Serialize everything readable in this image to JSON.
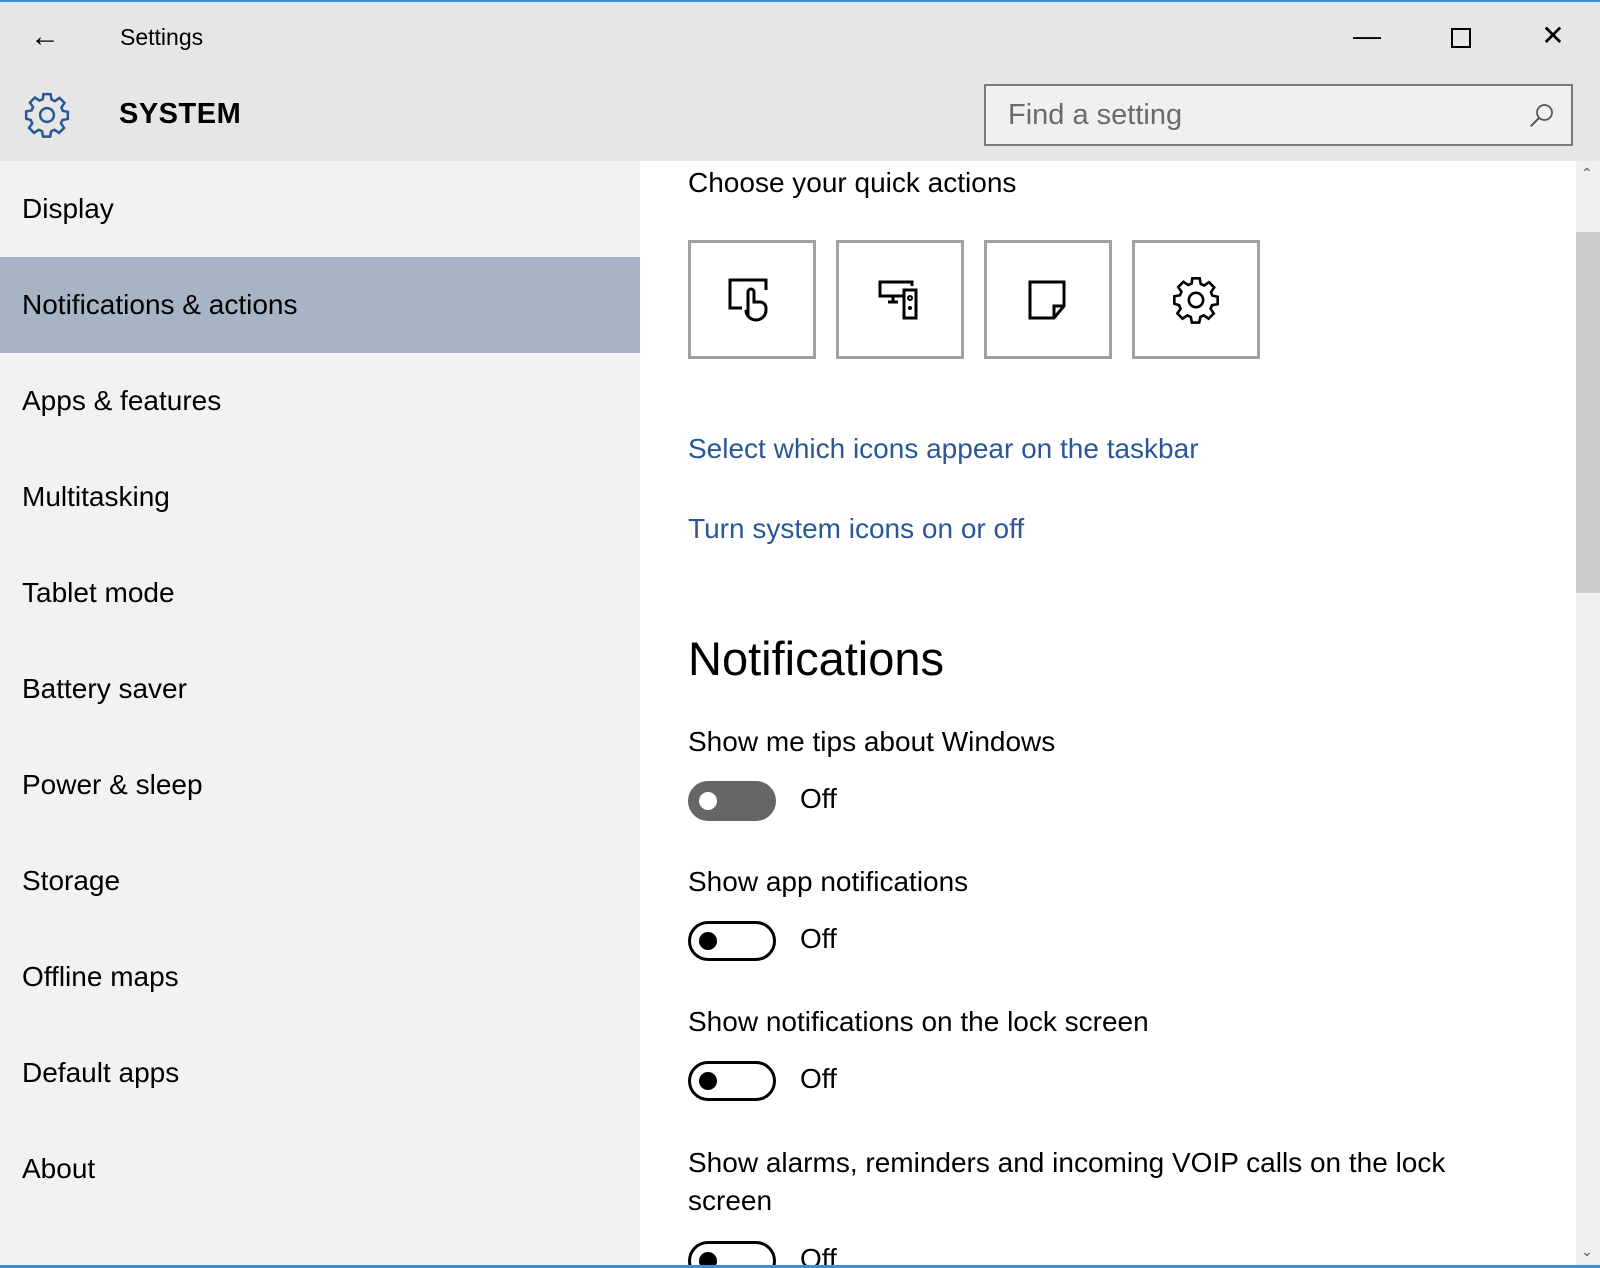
{
  "window": {
    "title": "Settings",
    "back_icon": "arrow-left-icon",
    "minimize_icon": "minimize-icon",
    "maximize_icon": "maximize-icon",
    "close_icon": "close-icon"
  },
  "header": {
    "title": "SYSTEM",
    "icon": "gear-icon",
    "search_placeholder": "Find a setting",
    "search_icon": "search-icon"
  },
  "sidebar": {
    "selected": "Notifications & actions",
    "items": [
      {
        "label": "Display"
      },
      {
        "label": "Notifications & actions"
      },
      {
        "label": "Apps & features"
      },
      {
        "label": "Multitasking"
      },
      {
        "label": "Tablet mode"
      },
      {
        "label": "Battery saver"
      },
      {
        "label": "Power & sleep"
      },
      {
        "label": "Storage"
      },
      {
        "label": "Offline maps"
      },
      {
        "label": "Default apps"
      },
      {
        "label": "About"
      }
    ]
  },
  "main": {
    "quick_actions_title": "Choose your quick actions",
    "quick_actions": [
      {
        "icon": "tablet-mode-icon"
      },
      {
        "icon": "connect-devices-icon"
      },
      {
        "icon": "note-icon"
      },
      {
        "icon": "settings-gear-icon"
      }
    ],
    "links": [
      "Select which icons appear on the taskbar",
      "Turn system icons on or off"
    ],
    "notifications_heading": "Notifications",
    "settings": [
      {
        "label": "Show me tips about Windows",
        "state": "Off",
        "on": false
      },
      {
        "label": "Show app notifications",
        "state": "Off",
        "on": false
      },
      {
        "label": "Show notifications on the lock screen",
        "state": "Off",
        "on": false
      },
      {
        "label": "Show alarms, reminders and incoming VOIP calls on the lock screen",
        "state": "Off",
        "on": false
      }
    ]
  },
  "colors": {
    "accent": "#3b8fd6",
    "selected_item": "#a7b4c6",
    "link": "#2b5797",
    "toggle_focused": "#666666"
  }
}
